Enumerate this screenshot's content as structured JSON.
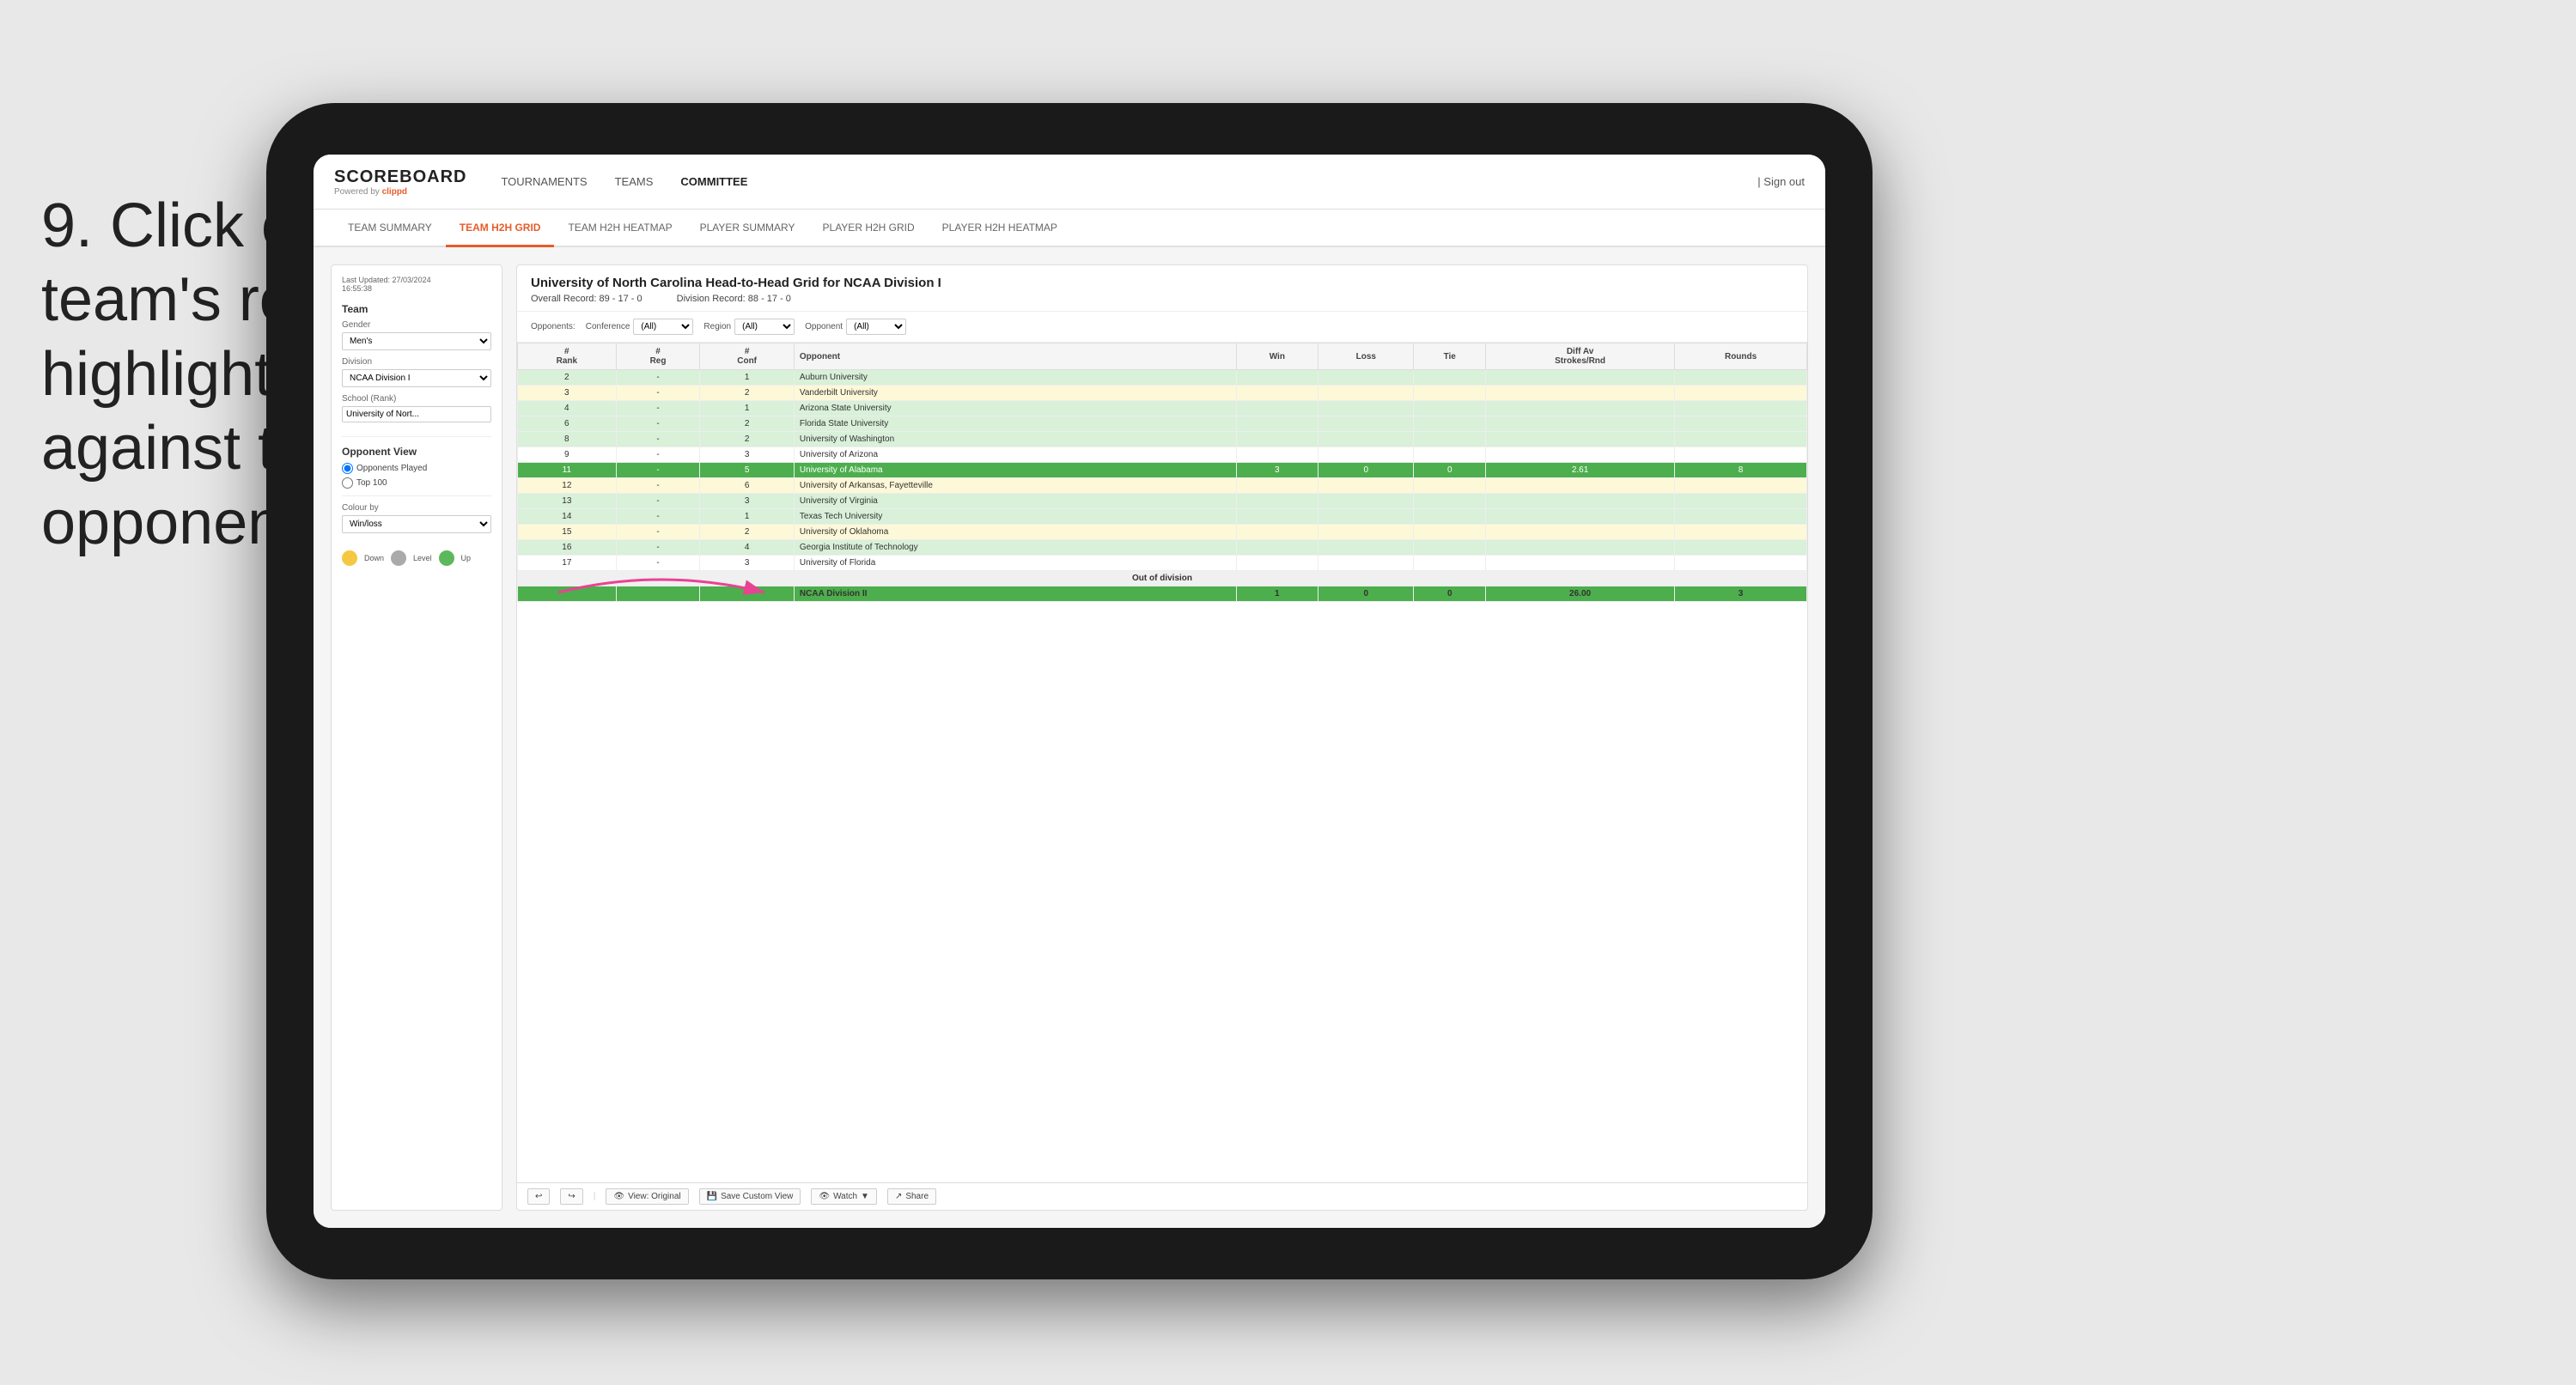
{
  "instruction": {
    "step": "9.",
    "text": "Click on a team's row to highlight results against that opponent"
  },
  "nav": {
    "logo": "SCOREBOARD",
    "powered_by": "Powered by clippd",
    "items": [
      "TOURNAMENTS",
      "TEAMS",
      "COMMITTEE"
    ],
    "active_item": "COMMITTEE",
    "signin": "Sign out"
  },
  "sub_nav": {
    "items": [
      "TEAM SUMMARY",
      "TEAM H2H GRID",
      "TEAM H2H HEATMAP",
      "PLAYER SUMMARY",
      "PLAYER H2H GRID",
      "PLAYER H2H HEATMAP"
    ],
    "active": "TEAM H2H GRID"
  },
  "left_panel": {
    "last_updated_label": "Last Updated: 27/03/2024",
    "time": "16:55:38",
    "team_label": "Team",
    "gender_label": "Gender",
    "gender_value": "Men's",
    "division_label": "Division",
    "division_value": "NCAA Division I",
    "school_label": "School (Rank)",
    "school_value": "University of Nort...",
    "opponent_view_label": "Opponent View",
    "radio_opponents": "Opponents Played",
    "radio_top100": "Top 100",
    "colour_by_label": "Colour by",
    "colour_value": "Win/loss",
    "legend_down": "Down",
    "legend_level": "Level",
    "legend_up": "Up"
  },
  "grid": {
    "title": "University of North Carolina Head-to-Head Grid for NCAA Division I",
    "overall_record_label": "Overall Record:",
    "overall_record": "89 - 17 - 0",
    "division_record_label": "Division Record:",
    "division_record": "88 - 17 - 0",
    "filters": {
      "opponents_label": "Opponents:",
      "conference_label": "Conference",
      "conference_value": "(All)",
      "region_label": "Region",
      "region_value": "(All)",
      "opponent_label": "Opponent",
      "opponent_value": "(All)"
    },
    "columns": [
      "#\nRank",
      "#\nReg",
      "#\nConf",
      "Opponent",
      "Win",
      "Loss",
      "Tie",
      "Diff Av\nStrokes/Rnd",
      "Rounds"
    ],
    "rows": [
      {
        "rank": "2",
        "reg": "-",
        "conf": "1",
        "opponent": "Auburn University",
        "win": "",
        "loss": "",
        "tie": "",
        "diff": "",
        "rounds": "",
        "style": "light-green"
      },
      {
        "rank": "3",
        "reg": "-",
        "conf": "2",
        "opponent": "Vanderbilt University",
        "win": "",
        "loss": "",
        "tie": "",
        "diff": "",
        "rounds": "",
        "style": "light-yellow"
      },
      {
        "rank": "4",
        "reg": "-",
        "conf": "1",
        "opponent": "Arizona State University",
        "win": "",
        "loss": "",
        "tie": "",
        "diff": "",
        "rounds": "",
        "style": "light-green"
      },
      {
        "rank": "6",
        "reg": "-",
        "conf": "2",
        "opponent": "Florida State University",
        "win": "",
        "loss": "",
        "tie": "",
        "diff": "",
        "rounds": "",
        "style": "light-green"
      },
      {
        "rank": "8",
        "reg": "-",
        "conf": "2",
        "opponent": "University of Washington",
        "win": "",
        "loss": "",
        "tie": "",
        "diff": "",
        "rounds": "",
        "style": "light-green"
      },
      {
        "rank": "9",
        "reg": "-",
        "conf": "3",
        "opponent": "University of Arizona",
        "win": "",
        "loss": "",
        "tie": "",
        "diff": "",
        "rounds": "",
        "style": "plain"
      },
      {
        "rank": "11",
        "reg": "-",
        "conf": "5",
        "opponent": "University of Alabama",
        "win": "3",
        "loss": "0",
        "tie": "0",
        "diff": "2.61",
        "rounds": "8",
        "style": "highlighted"
      },
      {
        "rank": "12",
        "reg": "-",
        "conf": "6",
        "opponent": "University of Arkansas, Fayetteville",
        "win": "",
        "loss": "",
        "tie": "",
        "diff": "",
        "rounds": "",
        "style": "light-yellow"
      },
      {
        "rank": "13",
        "reg": "-",
        "conf": "3",
        "opponent": "University of Virginia",
        "win": "",
        "loss": "",
        "tie": "",
        "diff": "",
        "rounds": "",
        "style": "light-green"
      },
      {
        "rank": "14",
        "reg": "-",
        "conf": "1",
        "opponent": "Texas Tech University",
        "win": "",
        "loss": "",
        "tie": "",
        "diff": "",
        "rounds": "",
        "style": "light-green"
      },
      {
        "rank": "15",
        "reg": "-",
        "conf": "2",
        "opponent": "University of Oklahoma",
        "win": "",
        "loss": "",
        "tie": "",
        "diff": "",
        "rounds": "",
        "style": "light-yellow"
      },
      {
        "rank": "16",
        "reg": "-",
        "conf": "4",
        "opponent": "Georgia Institute of Technology",
        "win": "",
        "loss": "",
        "tie": "",
        "diff": "",
        "rounds": "",
        "style": "light-green"
      },
      {
        "rank": "17",
        "reg": "-",
        "conf": "3",
        "opponent": "University of Florida",
        "win": "",
        "loss": "",
        "tie": "",
        "diff": "",
        "rounds": "",
        "style": "plain"
      }
    ],
    "out_of_division_label": "Out of division",
    "out_of_division_row": {
      "division": "NCAA Division II",
      "win": "1",
      "loss": "0",
      "tie": "0",
      "diff": "26.00",
      "rounds": "3"
    },
    "toolbar": {
      "undo": "↩",
      "redo": "↪",
      "view_original": "View: Original",
      "save_custom": "Save Custom View",
      "watch": "Watch",
      "share": "Share"
    }
  }
}
